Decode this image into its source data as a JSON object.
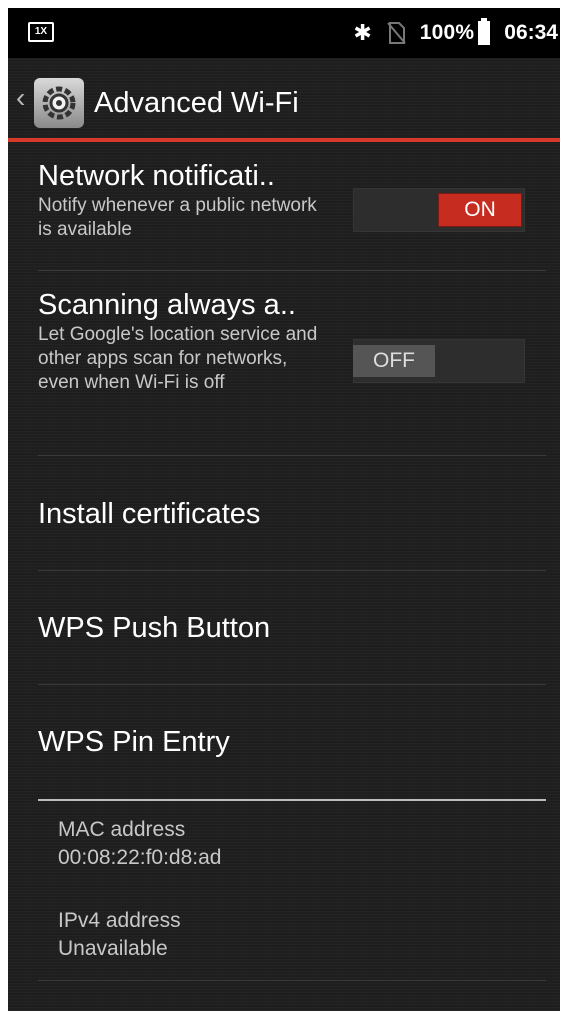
{
  "status_bar": {
    "left_icon": "screenshot-icon",
    "bluetooth_icon": "bluetooth-icon",
    "sim_icon": "no-sim-icon",
    "battery_percent": "100%",
    "time": "06:34"
  },
  "action_bar": {
    "title": "Advanced Wi-Fi",
    "app_icon": "settings-gear-icon",
    "accent_color": "#d63a2a"
  },
  "prefs": {
    "network_notification": {
      "title": "Network notificati..",
      "summary": "Notify whenever a public network is available",
      "toggle": "ON"
    },
    "scanning": {
      "title": "Scanning always a..",
      "summary": "Let Google's location service and other apps scan for networks, even when Wi-Fi is off",
      "toggle": "OFF"
    },
    "install_certificates": {
      "title": "Install certificates"
    },
    "wps_push": {
      "title": "WPS Push Button"
    },
    "wps_pin": {
      "title": "WPS Pin Entry"
    }
  },
  "info": {
    "mac_label": "MAC address",
    "mac_value": "00:08:22:f0:d8:ad",
    "ipv4_label": "IPv4 address",
    "ipv4_value": "Unavailable"
  }
}
